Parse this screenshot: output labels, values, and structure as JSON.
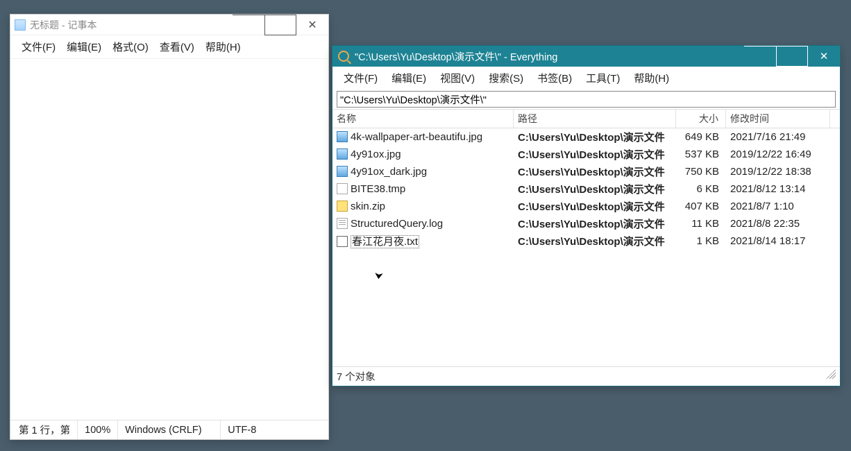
{
  "notepad": {
    "title": "无标题 - 记事本",
    "menu": [
      "文件(F)",
      "编辑(E)",
      "格式(O)",
      "查看(V)",
      "帮助(H)"
    ],
    "status": {
      "pos": "第 1 行，第",
      "zoom": "100%",
      "eol": "Windows (CRLF)",
      "encoding": "UTF-8"
    }
  },
  "everything": {
    "title": "\"C:\\Users\\Yu\\Desktop\\演示文件\\\"  - Everything",
    "menu": [
      "文件(F)",
      "编辑(E)",
      "视图(V)",
      "搜索(S)",
      "书签(B)",
      "工具(T)",
      "帮助(H)"
    ],
    "search_value": "\"C:\\Users\\Yu\\Desktop\\演示文件\\\"",
    "columns": {
      "name": "名称",
      "path": "路径",
      "size": "大小",
      "date": "修改时间"
    },
    "rows": [
      {
        "icon": "img",
        "name": "4k-wallpaper-art-beautifu.jpg",
        "path": "C:\\Users\\Yu\\Desktop\\演示文件",
        "size": "649 KB",
        "date": "2021/7/16 21:49"
      },
      {
        "icon": "img",
        "name": "4y91ox.jpg",
        "path": "C:\\Users\\Yu\\Desktop\\演示文件",
        "size": "537 KB",
        "date": "2019/12/22 16:49"
      },
      {
        "icon": "img",
        "name": "4y91ox_dark.jpg",
        "path": "C:\\Users\\Yu\\Desktop\\演示文件",
        "size": "750 KB",
        "date": "2019/12/22 18:38"
      },
      {
        "icon": "file",
        "name": "BITE38.tmp",
        "path": "C:\\Users\\Yu\\Desktop\\演示文件",
        "size": "6 KB",
        "date": "2021/8/12 13:14"
      },
      {
        "icon": "zip",
        "name": "skin.zip",
        "path": "C:\\Users\\Yu\\Desktop\\演示文件",
        "size": "407 KB",
        "date": "2021/8/7 1:10"
      },
      {
        "icon": "log",
        "name": "StructuredQuery.log",
        "path": "C:\\Users\\Yu\\Desktop\\演示文件",
        "size": "11 KB",
        "date": "2021/8/8 22:35"
      },
      {
        "icon": "txt",
        "name": "春江花月夜.txt",
        "path": "C:\\Users\\Yu\\Desktop\\演示文件",
        "size": "1 KB",
        "date": "2021/8/14 18:17",
        "selected": true
      }
    ],
    "status": "7 个对象"
  }
}
